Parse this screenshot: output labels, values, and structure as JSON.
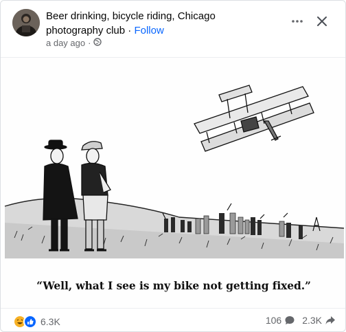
{
  "post": {
    "group_title": "Beer drinking, bicycle riding, Chicago photography club",
    "separator": " · ",
    "follow_label": "Follow",
    "time_ago": "a day ago",
    "time_separator": "·",
    "audience_icon": "globe-icon"
  },
  "image": {
    "caption": "“Well, what I see is my bike not getting fixed.”"
  },
  "footer": {
    "reaction_icons": [
      "haha-icon",
      "like-icon"
    ],
    "reaction_count": "6.3K",
    "comment_count": "106",
    "comment_icon": "comment-icon",
    "share_count": "2.3K",
    "share_icon": "share-icon"
  },
  "colors": {
    "accent": "#0866ff",
    "secondary_text": "#65676b",
    "haha": "#f7b125",
    "like": "#0866ff"
  }
}
